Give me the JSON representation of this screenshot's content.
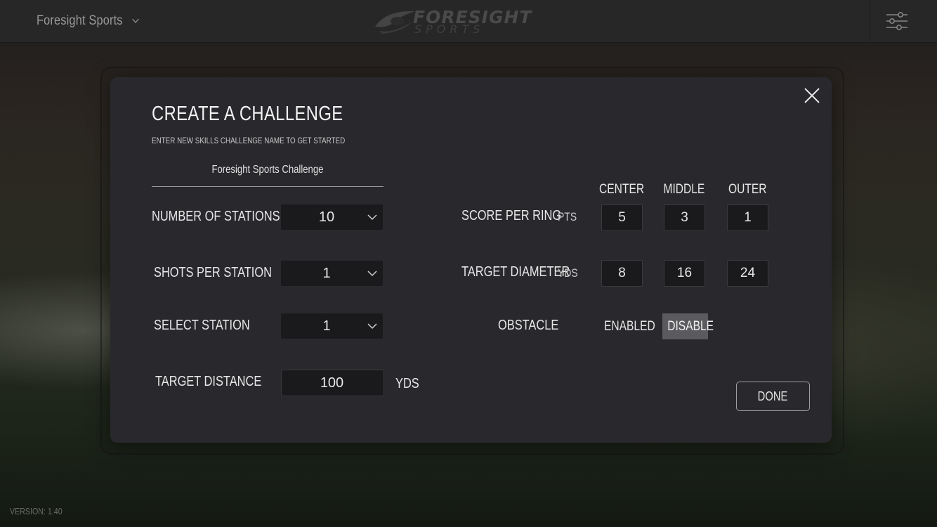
{
  "header": {
    "brand_selector": "Foresight Sports",
    "logo_main": "FORESIGHT",
    "logo_sub": "SPORTS"
  },
  "modal": {
    "title": "CREATE A CHALLENGE",
    "subtitle": "ENTER NEW SKILLS CHALLENGE NAME TO GET STARTED",
    "challenge_name": "Foresight Sports Challenge",
    "number_of_stations": {
      "label": "NUMBER OF STATIONS",
      "value": "10"
    },
    "shots_per_station": {
      "label": "SHOTS PER STATION",
      "value": "1"
    },
    "select_station": {
      "label": "SELECT STATION",
      "value": "1"
    },
    "target_distance": {
      "label": "TARGET DISTANCE",
      "value": "100",
      "unit": "YDS"
    },
    "columns": [
      "CENTER",
      "MIDDLE",
      "OUTER"
    ],
    "score_per_ring": {
      "label": "SCORE PER RING",
      "unit": "PTS",
      "values": [
        "5",
        "3",
        "1"
      ]
    },
    "target_diameter": {
      "label": "TARGET DIAMETER",
      "unit": "YDS",
      "values": [
        "8",
        "16",
        "24"
      ]
    },
    "obstacle": {
      "label": "OBSTACLE",
      "enabled": "ENABLED",
      "disable": "DISABLE",
      "selected": "DISABLE"
    },
    "done_label": "DONE"
  },
  "footer": {
    "version": "VERSION: 1.40"
  },
  "colors": {
    "modal_bg": "#29292d",
    "field_bg": "#1a1a1c",
    "toggle_active": "#5b5b5f"
  },
  "icons": [
    "chevron-down-icon",
    "foresight-logo-icon",
    "sliders-menu-icon",
    "close-icon"
  ]
}
